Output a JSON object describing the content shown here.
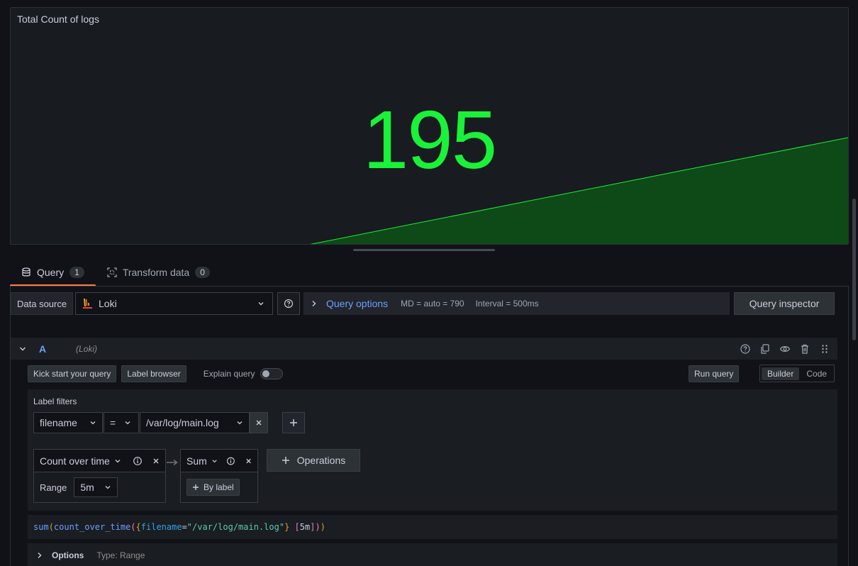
{
  "panel": {
    "title": "Total Count of logs",
    "stat_value": "195",
    "stat_color": "#19f239"
  },
  "tabs": [
    {
      "label": "Query",
      "count": "1"
    },
    {
      "label": "Transform data",
      "count": "0"
    }
  ],
  "datasource": {
    "label": "Data source",
    "selected": "Loki"
  },
  "query_options": {
    "title": "Query options",
    "md": "MD = auto = 790",
    "interval": "Interval = 500ms"
  },
  "query_inspector": "Query inspector",
  "query": {
    "ref_id": "A",
    "ds_name": "(Loki)",
    "kick_start": "Kick start your query",
    "label_browser": "Label browser",
    "explain": "Explain query",
    "run": "Run query",
    "mode_builder": "Builder",
    "mode_code": "Code",
    "label_filters_title": "Label filters",
    "filter": {
      "label": "filename",
      "op": "=",
      "value": "/var/log/main.log"
    },
    "operations": [
      {
        "name": "Count over time",
        "param_label": "Range",
        "param_value": "5m"
      },
      {
        "name": "Sum",
        "by_label": "By label"
      }
    ],
    "operations_btn": "Operations",
    "preview": {
      "fn1": "sum",
      "fn2": "count_over_time",
      "label": "filename",
      "op": "=",
      "value": "\"/var/log/main.log\"",
      "range": "5m"
    },
    "options_label": "Options",
    "options_meta": "Type: Range"
  }
}
